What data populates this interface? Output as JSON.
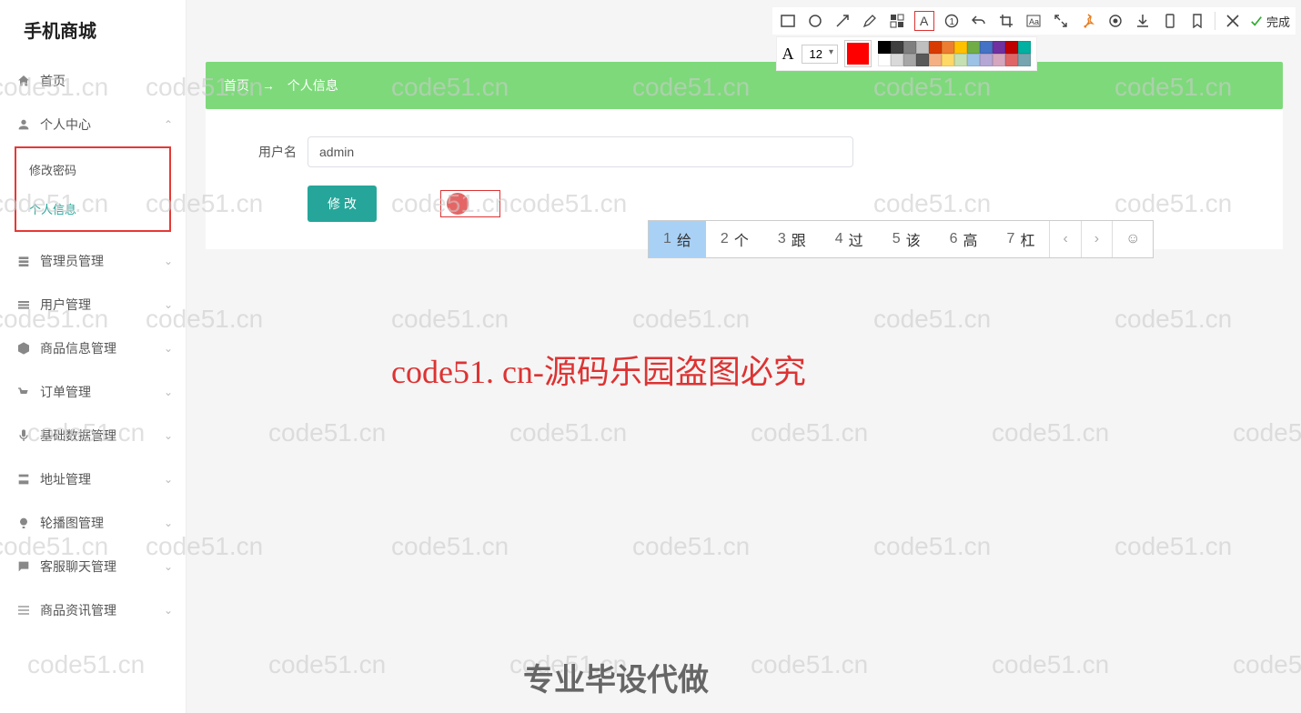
{
  "app": {
    "title": "手机商城"
  },
  "sidebar": {
    "home": "首页",
    "profile": {
      "label": "个人中心",
      "submenu": [
        {
          "label": "修改密码"
        },
        {
          "label": "个人信息",
          "active": true
        }
      ]
    },
    "items": [
      {
        "label": "管理员管理"
      },
      {
        "label": "用户管理"
      },
      {
        "label": "商品信息管理"
      },
      {
        "label": "订单管理"
      },
      {
        "label": "基础数据管理"
      },
      {
        "label": "地址管理"
      },
      {
        "label": "轮播图管理"
      },
      {
        "label": "客服聊天管理"
      },
      {
        "label": "商品资讯管理"
      }
    ]
  },
  "breadcrumb": {
    "home": "首页",
    "arrow": "→",
    "current": "个人信息"
  },
  "form": {
    "username_label": "用户名",
    "username_value": "admin",
    "submit_label": "修 改"
  },
  "ime": {
    "candidates": [
      {
        "n": "1",
        "t": "给"
      },
      {
        "n": "2",
        "t": "个"
      },
      {
        "n": "3",
        "t": "跟"
      },
      {
        "n": "4",
        "t": "过"
      },
      {
        "n": "5",
        "t": "该"
      },
      {
        "n": "6",
        "t": "高"
      },
      {
        "n": "7",
        "t": "杠"
      }
    ],
    "prev": "‹",
    "next": "›",
    "emoji": "☺"
  },
  "annotation": {
    "font_size": "12",
    "finish_label": "完成",
    "palette_row1": [
      "#000000",
      "#3f3f3f",
      "#7f7f7f",
      "#bfbfbf",
      "#d83b01",
      "#ed7d31",
      "#ffc000",
      "#70ad47",
      "#4472c4",
      "#7030a0",
      "#c00000",
      "#00b0a0"
    ],
    "palette_row2": [
      "#ffffff",
      "#d9d9d9",
      "#a6a6a6",
      "#595959",
      "#f4b083",
      "#ffd966",
      "#c5e0b3",
      "#9cc3e5",
      "#b4a7d6",
      "#d5a6bd",
      "#e06666",
      "#76a5af"
    ]
  },
  "watermarks": {
    "text": "code51.cn",
    "center": "code51. cn-源码乐园盗图必究",
    "bottom": "专业毕设代做"
  }
}
